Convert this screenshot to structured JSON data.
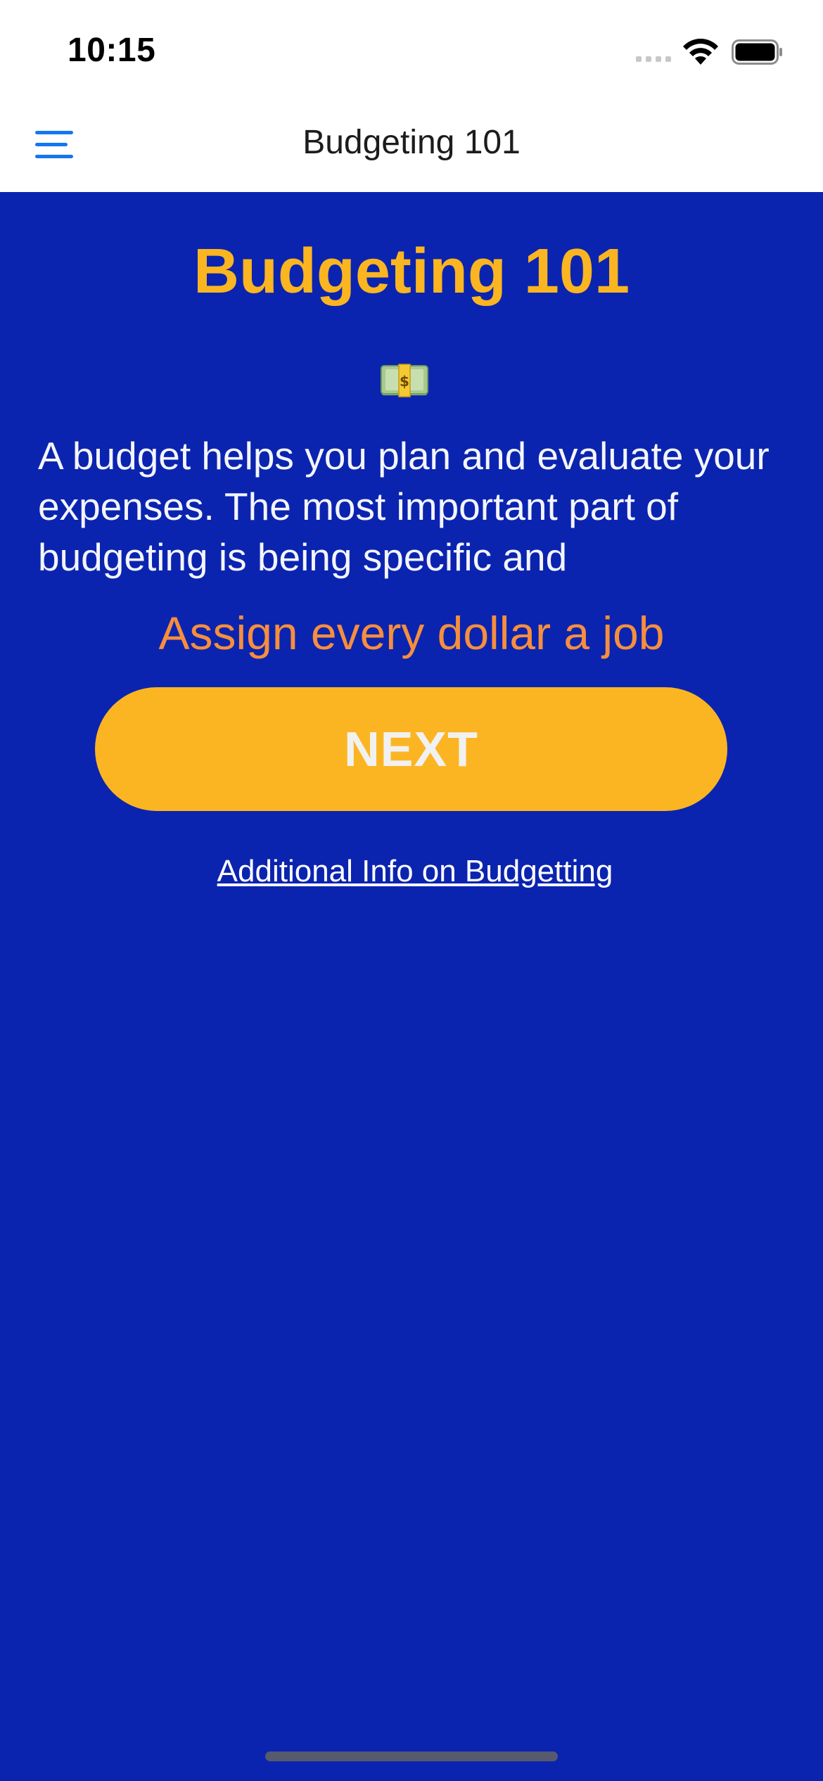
{
  "status_bar": {
    "time": "10:15",
    "icons": [
      "cellular-signal-icon",
      "wifi-icon",
      "battery-icon"
    ]
  },
  "nav_bar": {
    "menu_icon": "hamburger-menu-icon",
    "title": "Budgeting 101"
  },
  "content": {
    "heading": "Budgeting 101",
    "emoji": "money-bill-icon",
    "body": " A budget helps you plan and evaluate your expenses. The most important part of budgeting is being specific and",
    "tagline": "Assign every dollar a job",
    "next_label": "NEXT",
    "info_link": "Additional Info on Budgetting"
  },
  "colors": {
    "background": "#0b24af",
    "heading": "#fbb521",
    "tagline": "#f68e3e",
    "button": "#fcb522",
    "menu_icon": "#1476f0"
  }
}
